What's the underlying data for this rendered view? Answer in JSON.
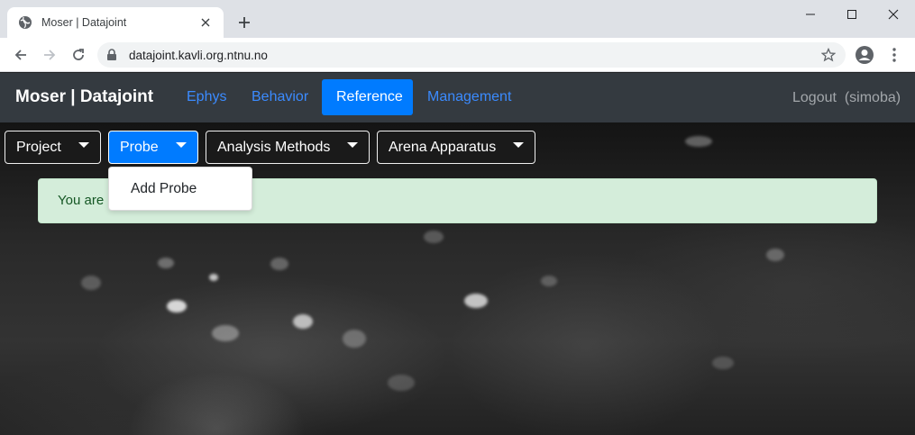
{
  "browser": {
    "tab_title": "Moser | Datajoint",
    "url": "datajoint.kavli.org.ntnu.no"
  },
  "navbar": {
    "brand": "Moser | Datajoint",
    "links": [
      "Ephys",
      "Behavior",
      "Reference",
      "Management"
    ],
    "active": "Reference",
    "logout_label": "Logout",
    "user": "(simoba)"
  },
  "subnav": {
    "buttons": [
      "Project",
      "Probe",
      "Analysis Methods",
      "Arena Apparatus"
    ],
    "open": "Probe"
  },
  "dropdown": {
    "items": [
      "Add Probe"
    ]
  },
  "alert": {
    "visible_text": "You are"
  },
  "colors": {
    "navbar_bg": "#343a40",
    "accent": "#007bff",
    "link": "#3b8bff",
    "alert_bg": "#d4edda",
    "alert_text": "#155724"
  }
}
